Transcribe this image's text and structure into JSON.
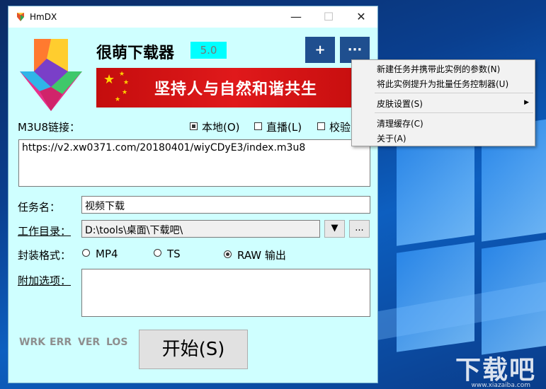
{
  "window": {
    "title": "HmDX"
  },
  "header": {
    "app_name": "很萌下载器",
    "version": "5.0",
    "add_label": "+",
    "more_label": "···"
  },
  "banner": {
    "text": "坚持人与自然和谐共生"
  },
  "m3u8": {
    "label": "M3U8链接：",
    "options": [
      {
        "label": "本地(O)",
        "checked": true
      },
      {
        "label": "直播(L)",
        "checked": false
      },
      {
        "label": "校验",
        "checked": false
      }
    ],
    "value": "https://v2.xw0371.com/20180401/wiyCDyE3/index.m3u8"
  },
  "task": {
    "label": "任务名：",
    "value": "视频下载"
  },
  "workdir": {
    "label": "工作目录：",
    "value": "D:\\tools\\桌面\\下载吧\\",
    "dropdown_label": "▼",
    "browse_label": "..."
  },
  "format": {
    "label": "封装格式：",
    "options": [
      {
        "label": "MP4",
        "selected": false
      },
      {
        "label": "TS",
        "selected": false
      },
      {
        "label": "RAW 输出",
        "selected": true
      }
    ]
  },
  "extra": {
    "label": "附加选项：",
    "value": ""
  },
  "status": [
    "WRK",
    "ERR",
    "VER",
    "LOS"
  ],
  "start": {
    "label": "开始(S)"
  },
  "context_menu": {
    "items": [
      {
        "label": "新建任务并携带此实例的参数(N)"
      },
      {
        "label": "将此实例提升为批量任务控制器(U)"
      },
      {
        "label": "皮肤设置(S)",
        "submenu": true
      },
      {
        "label": "清理缓存(C)"
      },
      {
        "label": "关于(A)"
      }
    ]
  },
  "desktop": {
    "watermark": "下载吧",
    "watermark_url": "www.xiazaiba.com"
  },
  "colors": {
    "window_bg": "#cfffff",
    "accent_button": "#1f4f8f",
    "version_bg": "#00ffff",
    "banner_red": "#e0191b"
  }
}
